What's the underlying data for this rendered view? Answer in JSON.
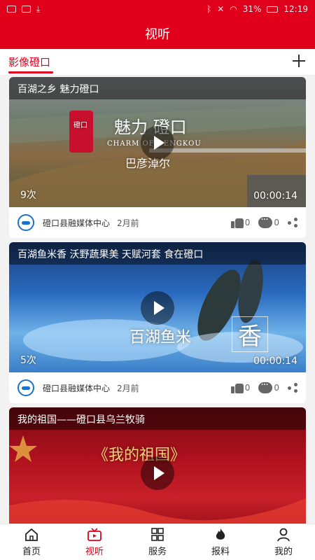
{
  "status_bar": {
    "battery": "31%",
    "time": "12:19"
  },
  "header": {
    "title": "视听"
  },
  "tabs": {
    "active_label": "影像磴口"
  },
  "feed": [
    {
      "title": "百湖之乡 魅力磴口",
      "overlay": {
        "line1": "魅力  磴口",
        "line2": "CHARM OF DENGKOU",
        "line3": "巴彦淖尔",
        "badge": "磴口"
      },
      "views": "9次",
      "duration": "00:00:14",
      "source": "磴口县融媒体中心",
      "time": "2月前",
      "likes": "0",
      "comments": "0"
    },
    {
      "title": "百湖鱼米香 沃野蔬果美 天赋河套 食在磴口",
      "overlay": {
        "line1": "百湖鱼米",
        "line2": "香"
      },
      "views": "5次",
      "duration": "00:00:14",
      "source": "磴口县融媒体中心",
      "time": "2月前",
      "likes": "0",
      "comments": "0"
    },
    {
      "title": "我的祖国——磴口县乌兰牧骑",
      "overlay": {
        "line1": "《我的祖国》"
      },
      "views": "",
      "duration": "",
      "source": "",
      "time": "",
      "likes": "",
      "comments": ""
    }
  ],
  "nav": [
    {
      "label": "首页",
      "icon": "home-icon"
    },
    {
      "label": "视听",
      "icon": "tv-icon",
      "active": true
    },
    {
      "label": "服务",
      "icon": "grid-icon"
    },
    {
      "label": "报料",
      "icon": "flame-icon"
    },
    {
      "label": "我的",
      "icon": "user-icon"
    }
  ],
  "colors": {
    "brand_red": "#e0001b"
  }
}
